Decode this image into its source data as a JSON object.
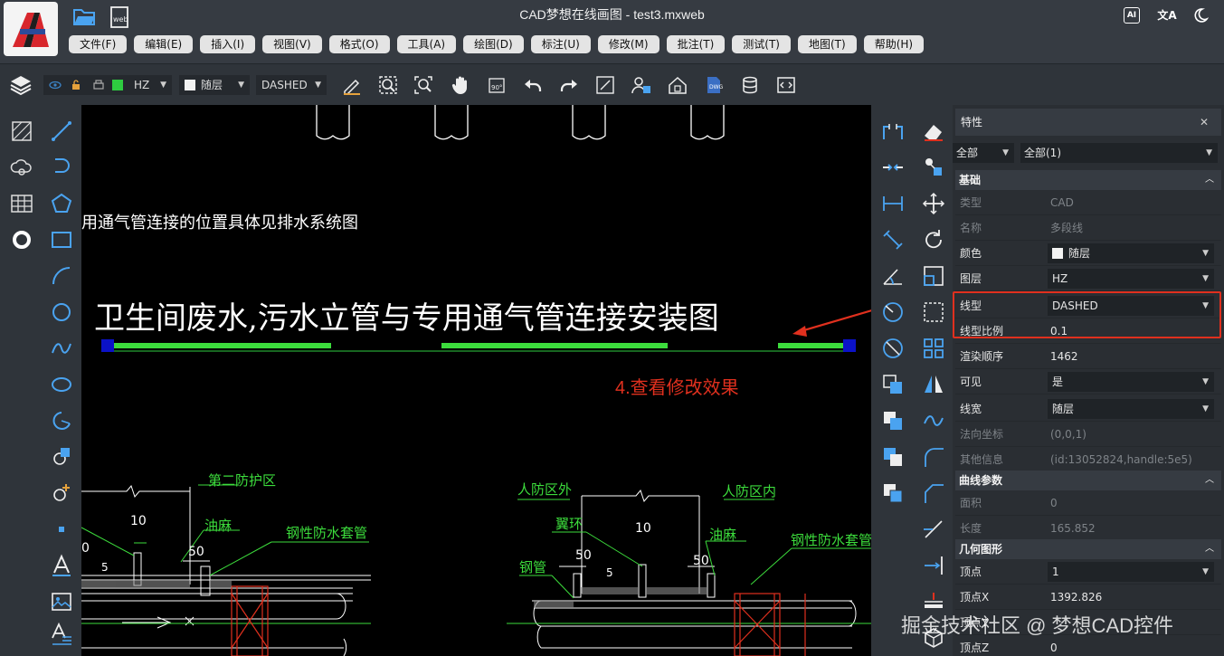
{
  "app": {
    "title": "CAD梦想在线画图 - test3.mxweb",
    "ai_label": "AI",
    "translate_label": "文A"
  },
  "menu": [
    "文件(F)",
    "编辑(E)",
    "插入(I)",
    "视图(V)",
    "格式(O)",
    "工具(A)",
    "绘图(D)",
    "标注(U)",
    "修改(M)",
    "批注(T)",
    "测试(T)",
    "地图(T)",
    "帮助(H)"
  ],
  "toolbar": {
    "layer": "HZ",
    "layer_color": "#2ecc40",
    "color": "随层",
    "linetype": "DASHED"
  },
  "canvas": {
    "text_note": "用通气管连接的位置具体见排水系统图",
    "drawing_title": "卫生间废水,污水立管与专用通气管连接安装图",
    "annotation": "4.查看修改效果",
    "left_detail": {
      "zone": "第二防护区",
      "dim_10": "10",
      "dim_50": "50",
      "dim_5": "5",
      "dim_0": "0",
      "grease": "油麻",
      "sleeve": "钢性防水套管"
    },
    "right_detail": {
      "outside": "人防区外",
      "inside": "人防区内",
      "wing_ring": "翼环",
      "dim_10": "10",
      "dim_50a": "50",
      "dim_50b": "50",
      "grease": "油麻",
      "sleeve": "钢性防水套管",
      "steel_pipe": "钢管",
      "dim_5": "5"
    }
  },
  "properties": {
    "title": "特性",
    "filter_left": "全部",
    "filter_right": "全部(1)",
    "sections": {
      "basic": "基础",
      "curve": "曲线参数",
      "geometry": "几何图形"
    },
    "rows": {
      "type_k": "类型",
      "type_v": "CAD",
      "name_k": "名称",
      "name_v": "多段线",
      "color_k": "颜色",
      "color_v": "随层",
      "layer_k": "图层",
      "layer_v": "HZ",
      "linetype_k": "线型",
      "linetype_v": "DASHED",
      "ltscale_k": "线型比例",
      "ltscale_v": "0.1",
      "order_k": "渲染顺序",
      "order_v": "1462",
      "visible_k": "可见",
      "visible_v": "是",
      "lineweight_k": "线宽",
      "lineweight_v": "随层",
      "normal_k": "法向坐标",
      "normal_v": "(0,0,1)",
      "other_k": "其他信息",
      "other_v": "(id:13052824,handle:5e5)",
      "area_k": "面积",
      "area_v": "0",
      "length_k": "长度",
      "length_v": "165.852",
      "vertex_k": "顶点",
      "vertex_v": "1",
      "vx_k": "顶点X",
      "vx_v": "1392.826",
      "vy_k": "顶点Y",
      "vy_v": "",
      "vz_k": "顶点Z",
      "vz_v": "0"
    }
  },
  "watermark": "掘金技术社区 @ 梦想CAD控件"
}
